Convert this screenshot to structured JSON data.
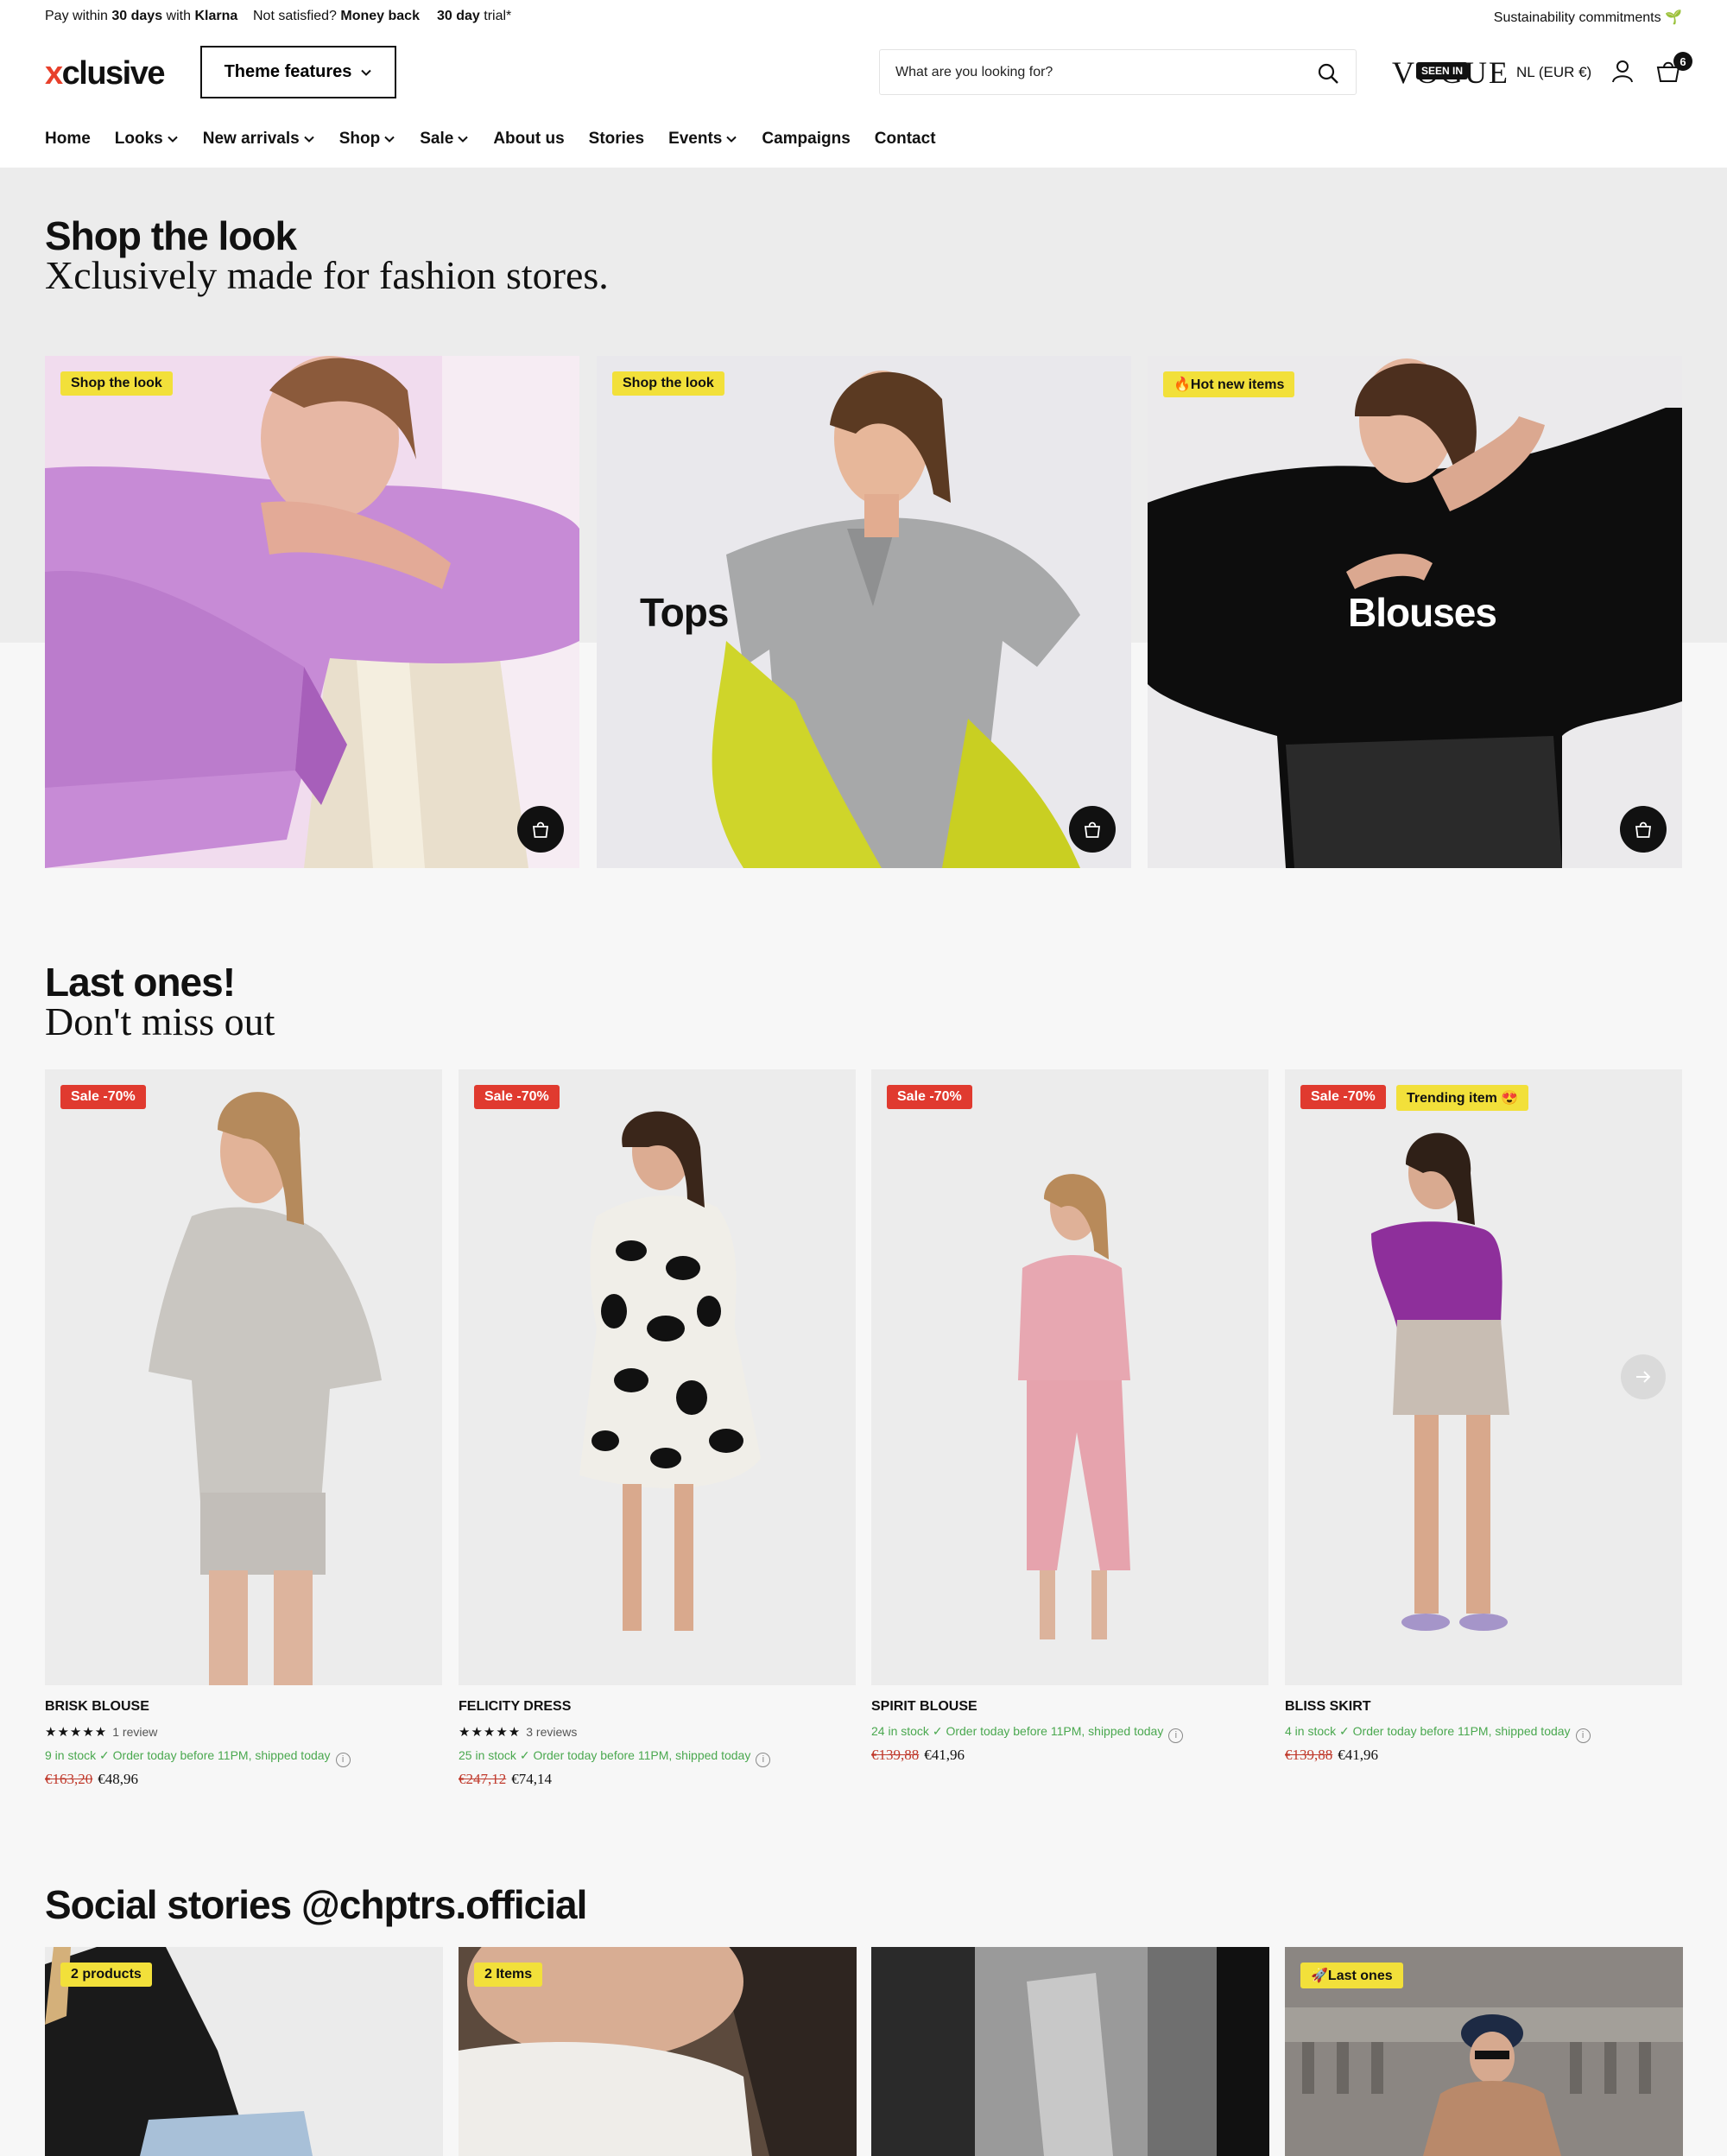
{
  "topbar": {
    "usp1_pre": "Pay within ",
    "usp1_bold": "30 days",
    "usp1_mid": " with ",
    "usp1_brand": "Klarna",
    "usp2_pre": "Not satisfied? ",
    "usp2_bold": "Money back",
    "usp3_bold": "30 day",
    "usp3_post": " trial*",
    "sustainability": "Sustainability commitments"
  },
  "header": {
    "logo_x": "x",
    "logo_rest": "clusive",
    "theme_button": "Theme features",
    "search_placeholder": "What are you looking for?",
    "vogue": "VOGUE",
    "seen_in": "SEEN IN",
    "locale": "NL (EUR €)",
    "cart_count": "6"
  },
  "nav": [
    {
      "label": "Home",
      "dropdown": false
    },
    {
      "label": "Looks",
      "dropdown": true
    },
    {
      "label": "New arrivals",
      "dropdown": true
    },
    {
      "label": "Shop",
      "dropdown": true
    },
    {
      "label": "Sale",
      "dropdown": true
    },
    {
      "label": "About us",
      "dropdown": false
    },
    {
      "label": "Stories",
      "dropdown": false
    },
    {
      "label": "Events",
      "dropdown": true
    },
    {
      "label": "Campaigns",
      "dropdown": false
    },
    {
      "label": "Contact",
      "dropdown": false
    }
  ],
  "hero": {
    "title": "Shop the look",
    "subtitle": "Xclusively made for fashion stores.",
    "cards": [
      {
        "label": "Shop the look",
        "title": ""
      },
      {
        "label": "Shop the look",
        "title": "Tops"
      },
      {
        "label": "🔥Hot new items",
        "title": "Blouses"
      }
    ]
  },
  "last_ones": {
    "title": "Last ones!",
    "subtitle": "Don't miss out",
    "products": [
      {
        "badge": "Sale -70%",
        "badge2": "",
        "name": "Brisk blouse",
        "stars": "★★★★★",
        "reviews": "1 review",
        "stock": "9 in stock",
        "ship": "Order today before 11PM, shipped today",
        "old_price": "€163,20",
        "price": "€48,96"
      },
      {
        "badge": "Sale -70%",
        "badge2": "",
        "name": "Felicity dress",
        "stars": "★★★★★",
        "reviews": "3 reviews",
        "stock": "25 in stock",
        "ship": "Order today before 11PM, shipped today",
        "old_price": "€247,12",
        "price": "€74,14"
      },
      {
        "badge": "Sale -70%",
        "badge2": "",
        "name": "Spirit blouse",
        "stars": "",
        "reviews": "",
        "stock": "24 in stock",
        "ship": "Order today before 11PM, shipped today",
        "old_price": "€139,88",
        "price": "€41,96"
      },
      {
        "badge": "Sale -70%",
        "badge2": "Trending item 😍",
        "name": "Bliss skirt",
        "stars": "",
        "reviews": "",
        "stock": "4 in stock",
        "ship": "Order today before 11PM, shipped today",
        "old_price": "€139,88",
        "price": "€41,96"
      }
    ]
  },
  "social": {
    "title": "Social stories @chptrs.official",
    "cards": [
      {
        "label": "2 products"
      },
      {
        "label": "2 Items"
      },
      {
        "label": ""
      },
      {
        "label": "🚀Last ones"
      }
    ]
  },
  "colors": {
    "accent_red": "#e03a2f",
    "label_yellow": "#f2e03a",
    "stock_green": "#4aa84f"
  }
}
